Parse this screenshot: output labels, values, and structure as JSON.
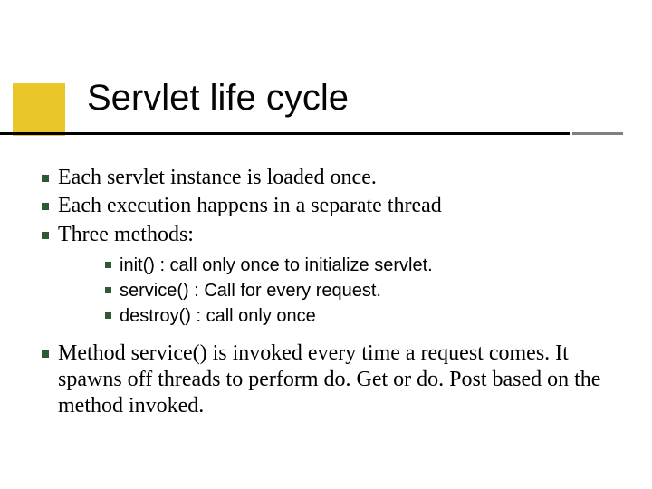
{
  "title": "Servlet life cycle",
  "colors": {
    "bullet": "#2f5a2f",
    "title_accent": "#e9c629",
    "underline_main": "#000000",
    "underline_tail": "#808080"
  },
  "bullets": [
    {
      "text": "Each servlet instance is loaded once."
    },
    {
      "text": "Each execution happens in a separate thread"
    },
    {
      "text": "Three methods:",
      "sub": [
        {
          "text": "init() : call only once to initialize servlet."
        },
        {
          "text": "service() : Call for every request."
        },
        {
          "text": "destroy() : call only once"
        }
      ]
    },
    {
      "text": "Method service() is invoked every time a request comes. It spawns off threads to perform do. Get or do. Post based on the method invoked."
    }
  ]
}
